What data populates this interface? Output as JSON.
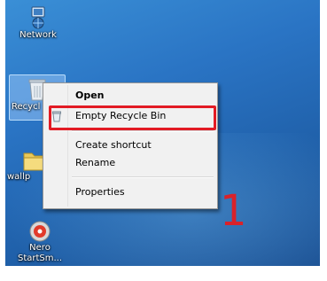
{
  "desktop": {
    "icons": [
      {
        "label": "Network",
        "icon": "network-icon"
      },
      {
        "label": "Recycl",
        "icon": "recycle-bin-icon"
      },
      {
        "label": "wallp",
        "icon": "folder-icon"
      },
      {
        "label": "Nero StartSm...",
        "icon": "nero-icon"
      }
    ]
  },
  "context_menu": {
    "items": [
      {
        "label": "Open",
        "bold": true
      },
      {
        "label": "Empty Recycle Bin",
        "icon": "recycle-bin-small-icon"
      },
      {
        "label": "Create shortcut"
      },
      {
        "label": "Rename"
      },
      {
        "label": "Properties"
      }
    ]
  },
  "annotation": {
    "text": "1",
    "color": "#d9222a"
  },
  "colors": {
    "highlight": "#e21b24",
    "menu_bg": "#f1f1f1"
  }
}
